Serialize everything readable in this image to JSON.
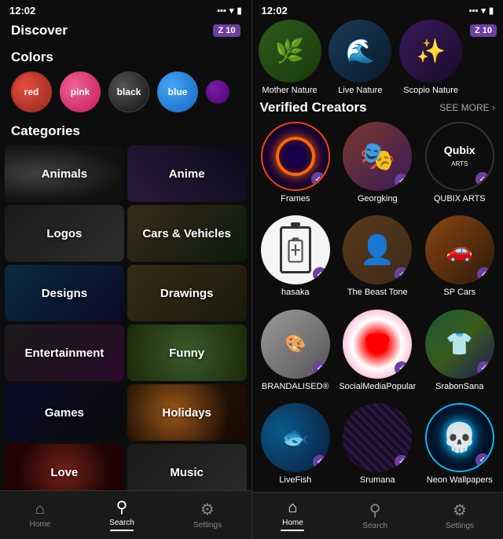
{
  "left": {
    "status": {
      "time": "12:02",
      "icons": [
        "signal",
        "wifi",
        "battery"
      ]
    },
    "header": {
      "title": "Discover",
      "badge": "Z 10"
    },
    "colors_section": {
      "label": "Colors",
      "items": [
        {
          "name": "red",
          "bg": "#c0392b",
          "label": "red"
        },
        {
          "name": "pink",
          "bg": "#e91e8c",
          "label": "pink"
        },
        {
          "name": "black",
          "bg": "#1a1a1a",
          "label": "black"
        },
        {
          "name": "blue",
          "bg": "#2196f3",
          "label": "blue"
        }
      ]
    },
    "categories_section": {
      "label": "Categories",
      "items": [
        {
          "name": "Animals",
          "class": "cat-animals"
        },
        {
          "name": "Anime",
          "class": "cat-anime"
        },
        {
          "name": "Logos",
          "class": "cat-logos"
        },
        {
          "name": "Cars & Vehicles",
          "class": "cat-cars"
        },
        {
          "name": "Designs",
          "class": "cat-designs"
        },
        {
          "name": "Drawings",
          "class": "cat-drawings"
        },
        {
          "name": "Entertainment",
          "class": "cat-entertainment"
        },
        {
          "name": "Funny",
          "class": "cat-funny"
        },
        {
          "name": "Games",
          "class": "cat-games"
        },
        {
          "name": "Holidays",
          "class": "cat-holidays"
        },
        {
          "name": "Love",
          "class": "cat-love"
        },
        {
          "name": "Music",
          "class": "cat-music"
        }
      ]
    },
    "nav": {
      "items": [
        {
          "label": "Home",
          "icon": "⌂",
          "active": false
        },
        {
          "label": "Search",
          "icon": "🔍",
          "active": true
        },
        {
          "label": "Settings",
          "icon": "⚙",
          "active": false
        }
      ]
    }
  },
  "right": {
    "status": {
      "time": "12:02"
    },
    "badge": "Z 10",
    "nature_row": {
      "items": [
        {
          "name": "Mother Nature",
          "class": "nc-mother"
        },
        {
          "name": "Live Nature",
          "class": "nc-live"
        },
        {
          "name": "Scopio Nature",
          "class": "nc-scopio"
        }
      ]
    },
    "verified_section": {
      "title": "Verified Creators",
      "see_more": "SEE MORE ›",
      "creators": [
        {
          "name": "Frames",
          "class": "av-frames",
          "type": "frames"
        },
        {
          "name": "Georgking",
          "class": "av-georgking",
          "type": "georgking"
        },
        {
          "name": "QUBIX ARTS",
          "class": "av-qubix",
          "type": "qubix"
        },
        {
          "name": "hasaka",
          "class": "av-hasaka",
          "type": "hasaka"
        },
        {
          "name": "The Beast Tone",
          "class": "av-beast",
          "type": "beast"
        },
        {
          "name": "SP Cars",
          "class": "av-spcars",
          "type": "spcars"
        },
        {
          "name": "BRANDALISED®",
          "class": "av-brandalised",
          "type": "brandalised"
        },
        {
          "name": "SocialMediaPopular",
          "class": "av-social",
          "type": "social"
        },
        {
          "name": "SrabonSana",
          "class": "av-srabon",
          "type": "srabon"
        },
        {
          "name": "LiveFish",
          "class": "av-livefish",
          "type": "livefish"
        },
        {
          "name": "Srumana",
          "class": "av-srumana",
          "type": "srumana"
        },
        {
          "name": "Neon Wallpapers",
          "class": "av-neon",
          "type": "neon"
        }
      ]
    },
    "nav": {
      "items": [
        {
          "label": "Home",
          "icon": "⌂",
          "active": true
        },
        {
          "label": "Search",
          "icon": "🔍",
          "active": false
        },
        {
          "label": "Settings",
          "icon": "⚙",
          "active": false
        }
      ]
    }
  }
}
